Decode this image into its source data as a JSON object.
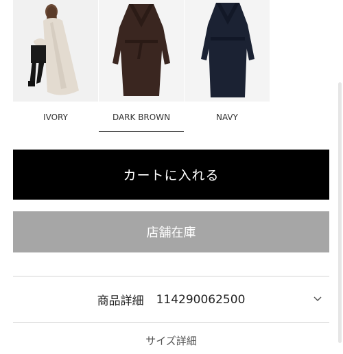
{
  "colors": [
    {
      "label": "IVORY",
      "selected": false
    },
    {
      "label": "DARK BROWN",
      "selected": true
    },
    {
      "label": "NAVY",
      "selected": false
    }
  ],
  "cart_button": {
    "label": "カートに入れる",
    "color": "#000000"
  },
  "store_button": {
    "label": "店舗在庫",
    "color": "#a6a6a6"
  },
  "product_detail": {
    "title": "商品詳細",
    "number": "114290062500",
    "icon": "chevron-down-icon"
  },
  "next_section": {
    "title": "サイズ詳細"
  }
}
